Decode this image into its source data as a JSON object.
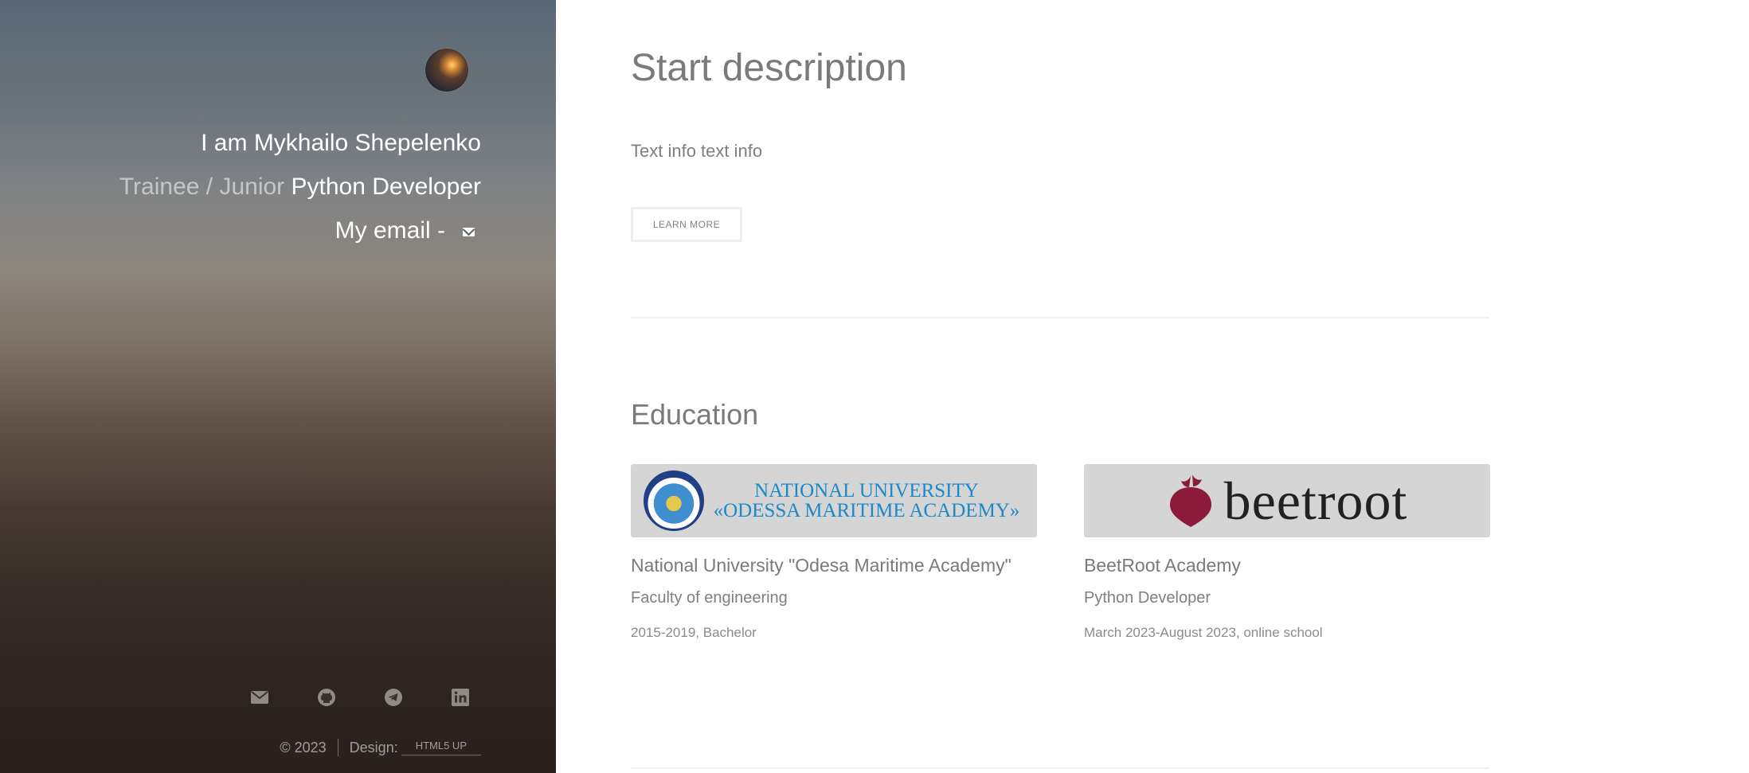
{
  "sidebar": {
    "avatar_alt": "avatar",
    "intro_name": "I am Mykhailo Shepelenko",
    "role_prefix": "Trainee / Junior",
    "role_main": "Python Developer",
    "email_label": "My email -",
    "social_icons": [
      "envelope-icon",
      "github-icon",
      "telegram-icon",
      "linkedin-icon"
    ],
    "footer": {
      "copyright": "© 2023",
      "design_label": "Design:",
      "design_link": "HTML5 UP"
    }
  },
  "main": {
    "start_title": "Start description",
    "start_text": "Text info text info",
    "learn_more": "LEARN MORE",
    "education_title": "Education",
    "education": [
      {
        "logo_line1": "NATIONAL UNIVERSITY",
        "logo_line2": "«ODESSA MARITIME ACADEMY»",
        "title": "National University \"Odesa Maritime Academy\"",
        "subtitle": "Faculty of engineering",
        "date": "2015-2019, Bachelor"
      },
      {
        "logo_word": "beetroot",
        "title": "BeetRoot Academy",
        "subtitle": "Python Developer",
        "date": "March 2023-August 2023, online school"
      }
    ]
  },
  "colors": {
    "accent_blue": "#1b88c8",
    "beet_red": "#8c1a3b",
    "text_gray": "#7f7f7f"
  }
}
